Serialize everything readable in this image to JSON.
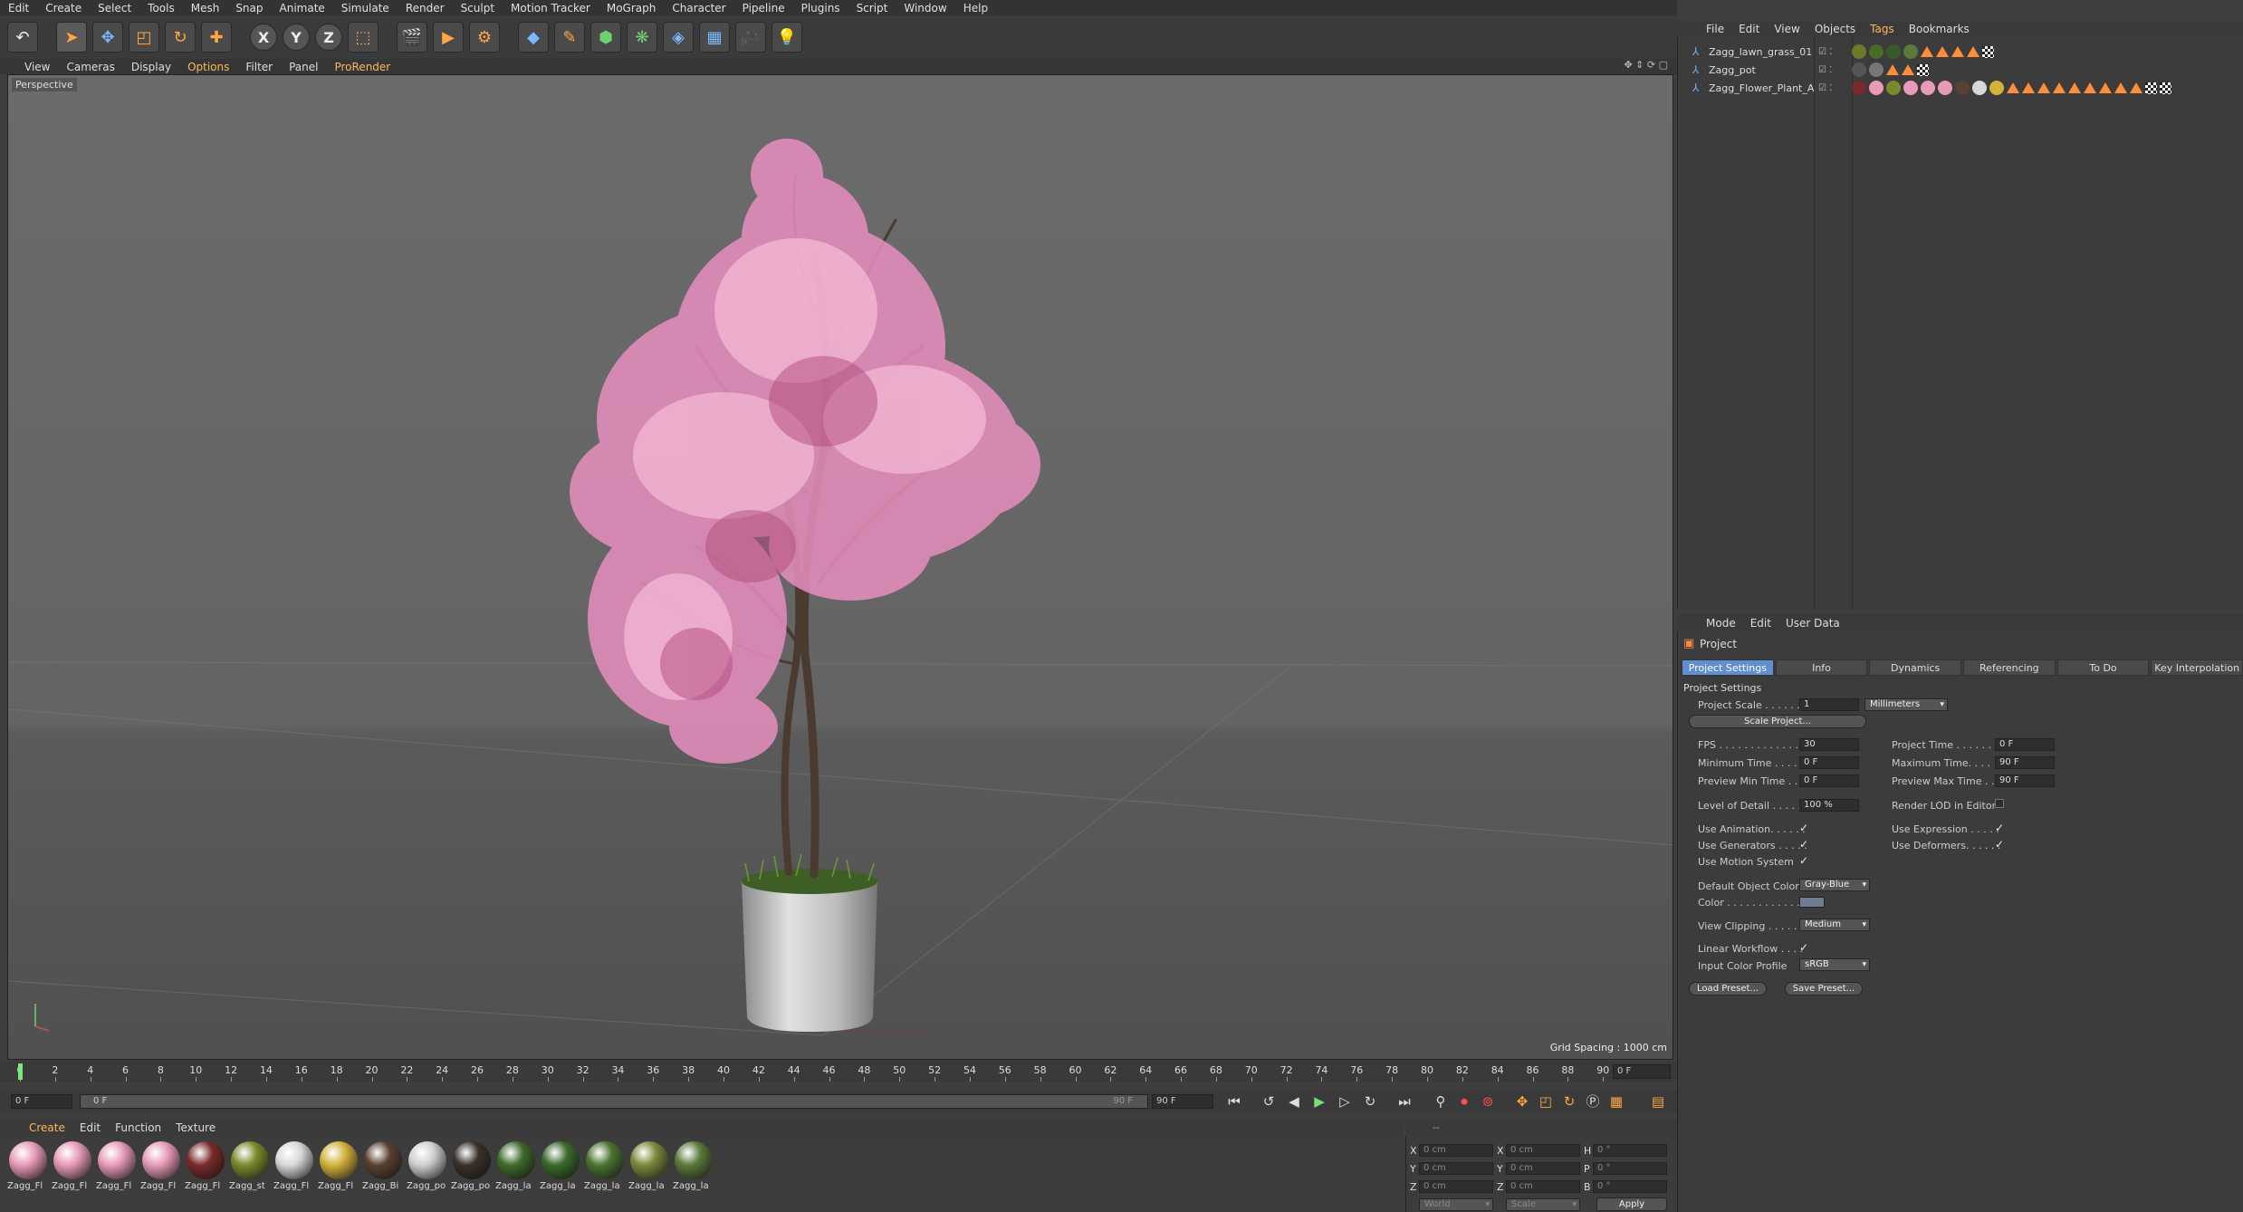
{
  "menubar": [
    "Edit",
    "Create",
    "Select",
    "Tools",
    "Mesh",
    "Snap",
    "Animate",
    "Simulate",
    "Render",
    "Sculpt",
    "Motion Tracker",
    "MoGraph",
    "Character",
    "Pipeline",
    "Plugins",
    "Script",
    "Window",
    "Help"
  ],
  "toolbar": {
    "icons": [
      "undo-icon",
      "select-arrow-icon",
      "move-icon",
      "scale-icon",
      "rotate-icon",
      "add-icon",
      "x-axis-icon",
      "y-axis-icon",
      "z-axis-icon",
      "coordinate-system-icon",
      "render-view-icon",
      "render-picture-viewer-icon",
      "render-settings-icon",
      "cube-icon",
      "pen-icon",
      "subdivision-icon",
      "cloner-icon",
      "deformer-icon",
      "floor-icon",
      "camera-icon",
      "light-icon"
    ],
    "x_label": "X",
    "y_label": "Y",
    "z_label": "Z"
  },
  "viewport_menu": [
    "View",
    "Cameras",
    "Display",
    "Options",
    "Filter",
    "Panel",
    "ProRender"
  ],
  "viewport": {
    "label": "Perspective",
    "grid_spacing": "Grid Spacing : 1000 cm"
  },
  "object_manager": {
    "menu": [
      "File",
      "Edit",
      "View",
      "Objects",
      "Tags",
      "Bookmarks"
    ],
    "objects": [
      {
        "name": "Zagg_lawn_grass_01"
      },
      {
        "name": "Zagg_pot"
      },
      {
        "name": "Zagg_Flower_Plant_A"
      }
    ]
  },
  "attributes": {
    "menu": [
      "Mode",
      "Edit",
      "User Data"
    ],
    "title": "Project",
    "tabs": [
      "Project Settings",
      "Info",
      "Dynamics",
      "Referencing",
      "To Do",
      "Key Interpolation"
    ],
    "section": "Project Settings",
    "project_scale_label": "Project Scale . . . . . .",
    "project_scale_value": "1",
    "project_scale_unit": "Millimeters",
    "scale_project_btn": "Scale Project...",
    "fps_label": "FPS . . . . . . . . . . . . . . . .",
    "fps_value": "30",
    "project_time_label": "Project Time . . . . . . .",
    "project_time_value": "0 F",
    "min_time_label": "Minimum Time . . . . . .",
    "min_time_value": "0 F",
    "max_time_label": "Maximum Time. . . . . .",
    "max_time_value": "90 F",
    "preview_min_label": "Preview Min Time . . .",
    "preview_min_value": "0 F",
    "preview_max_label": "Preview Max Time . . .",
    "preview_max_value": "90 F",
    "lod_label": "Level of Detail . . . . . .",
    "lod_value": "100 %",
    "render_lod_label": "Render LOD in Editor",
    "use_animation_label": "Use Animation. . . . . .",
    "use_expression_label": "Use Expression . . . . .",
    "use_generators_label": "Use Generators . . . . .",
    "use_deformers_label": "Use Deformers. . . . . .",
    "use_motion_label": "Use Motion System",
    "default_color_label": "Default Object Color",
    "default_color_value": "Gray-Blue",
    "color_label": "Color . . . . . . . . . . . . .",
    "view_clipping_label": "View Clipping . . . . . .",
    "view_clipping_value": "Medium",
    "linear_workflow_label": "Linear Workflow . . . .",
    "input_color_label": "Input Color Profile",
    "input_color_value": "sRGB",
    "load_preset_btn": "Load Preset...",
    "save_preset_btn": "Save Preset...",
    "check": "✓"
  },
  "timeline": {
    "ticks": [
      "0",
      "2",
      "4",
      "6",
      "8",
      "10",
      "12",
      "14",
      "16",
      "18",
      "20",
      "22",
      "24",
      "26",
      "28",
      "30",
      "32",
      "34",
      "36",
      "38",
      "40",
      "42",
      "44",
      "46",
      "48",
      "50",
      "52",
      "54",
      "56",
      "58",
      "60",
      "62",
      "64",
      "66",
      "68",
      "70",
      "72",
      "74",
      "76",
      "78",
      "80",
      "82",
      "84",
      "86",
      "88",
      "90"
    ],
    "end_field": "0 F",
    "current": "0 F",
    "range_start": "0 F",
    "range_end": "90 F",
    "max": "90 F"
  },
  "material_manager": {
    "menu": [
      "Create",
      "Edit",
      "Function",
      "Texture"
    ],
    "materials": [
      {
        "label": "Zagg_Fl",
        "color": "#e89bb8"
      },
      {
        "label": "Zagg_Fl",
        "color": "#e89bb8"
      },
      {
        "label": "Zagg_Fl",
        "color": "#e89bb8"
      },
      {
        "label": "Zagg_Fl",
        "color": "#e89bb8"
      },
      {
        "label": "Zagg_Fl",
        "color": "#7a2a2a"
      },
      {
        "label": "Zagg_st",
        "color": "#7a8a2a"
      },
      {
        "label": "Zagg_Fl",
        "color": "#d8d8d8"
      },
      {
        "label": "Zagg_Fl",
        "color": "#d4b23a"
      },
      {
        "label": "Zagg_Bi",
        "color": "#5a4030"
      },
      {
        "label": "Zagg_po",
        "color": "#cfcfcf"
      },
      {
        "label": "Zagg_po",
        "color": "#3a3028"
      },
      {
        "label": "Zagg_la",
        "color": "#3f6a2a"
      },
      {
        "label": "Zagg_la",
        "color": "#3a6a2a"
      },
      {
        "label": "Zagg_la",
        "color": "#4a7430"
      },
      {
        "label": "Zagg_la",
        "color": "#7a8a3a"
      },
      {
        "label": "Zagg_la",
        "color": "#5a7a3a"
      }
    ]
  },
  "coordinates": {
    "header": "--",
    "rows": [
      {
        "a": "X",
        "av": "0 cm",
        "b": "X",
        "bv": "0 cm",
        "c": "H",
        "cv": "0 °"
      },
      {
        "a": "Y",
        "av": "0 cm",
        "b": "Y",
        "bv": "0 cm",
        "c": "P",
        "cv": "0 °"
      },
      {
        "a": "Z",
        "av": "0 cm",
        "b": "Z",
        "bv": "0 cm",
        "c": "B",
        "cv": "0 °"
      }
    ],
    "world": "World",
    "scale": "Scale",
    "apply": "Apply"
  }
}
